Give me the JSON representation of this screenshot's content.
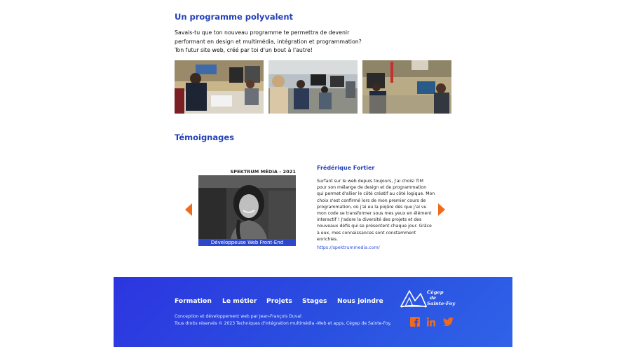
{
  "program": {
    "title": "Un programme polyvalent",
    "intro_lines": [
      "Savais-tu que ton nouveau programme te permettra de devenir",
      "performant en design et multimédia, intégration et programmation?",
      "Ton futur site web, créé par toi d'un bout à l'autre!"
    ]
  },
  "testimonials": {
    "title": "Témoignages",
    "caption": "SPEKTRUM MÉDIA - 2021",
    "role_label": "Développeuse Web Front-End",
    "name": "Frédérique Fortier",
    "body_lines": [
      "Surfant sur le web depuis toujours, j'ai choisi TIM",
      "pour son mélange de design et de programmation",
      "qui permet d'allier le côté créatif au côté logique. Mon",
      "choix s'est confirmé lors de mon premier cours de",
      "programmation, où j'ai eu la piqûre dès que j'ai vu",
      "mon code se transformer sous mes yeux en élément",
      "interactif ! J'adore la diversité des projets et des",
      "nouveaux défis qui se présentent chaque jour. Grâce",
      "à eux, mes connaissances sont constamment",
      "enrichies."
    ],
    "link": "https://spektrummedia.com/"
  },
  "footer": {
    "nav": [
      "Formation",
      "Le métier",
      "Projets",
      "Stages",
      "Nous joindre"
    ],
    "credits_lines": [
      "Conception et développement web par Jean-François Duval",
      "Tous droits réservés © 2023 Techniques d'intégration multimédia -Web et apps, Cégep de Sainte-Foy."
    ],
    "logo_lines": [
      "Cégep",
      "de",
      "Sainte-Foy"
    ],
    "social_icons": [
      "facebook-icon",
      "linkedin-icon",
      "twitter-icon"
    ]
  },
  "colors": {
    "heading_blue": "#2340b8",
    "accent_orange": "#f06a1b",
    "footer_blue": "#2c35e0"
  }
}
